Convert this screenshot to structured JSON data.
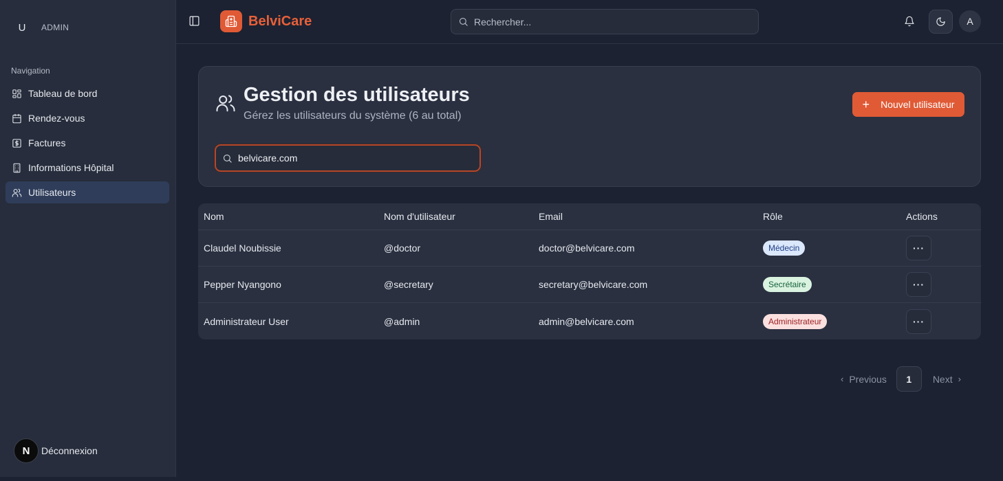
{
  "sidebar": {
    "user_initial": "U",
    "user_role": "ADMIN",
    "section_label": "Navigation",
    "items": [
      {
        "label": "Tableau de bord",
        "icon": "dashboard-icon"
      },
      {
        "label": "Rendez-vous",
        "icon": "calendar-icon"
      },
      {
        "label": "Factures",
        "icon": "invoice-icon"
      },
      {
        "label": "Informations Hôpital",
        "icon": "building-icon"
      },
      {
        "label": "Utilisateurs",
        "icon": "users-icon",
        "active": true
      }
    ],
    "logout_initial": "N",
    "logout_label": "Déconnexion"
  },
  "topbar": {
    "brand_name": "BelviCare",
    "search_placeholder": "Rechercher...",
    "user_initial": "A"
  },
  "header_card": {
    "title": "Gestion des utilisateurs",
    "subtitle": "Gérez les utilisateurs du système (6 au total)",
    "new_button_label": "Nouvel utilisateur",
    "search_value": "belvicare.com"
  },
  "table": {
    "columns": [
      "Nom",
      "Nom d'utilisateur",
      "Email",
      "Rôle",
      "Actions"
    ],
    "rows": [
      {
        "name": "Claudel Noubissie",
        "username": "@doctor",
        "email": "doctor@belvicare.com",
        "role": "Médecin",
        "role_bg": "#dbe7fb",
        "role_fg": "#1f3f86"
      },
      {
        "name": "Pepper Nyangono",
        "username": "@secretary",
        "email": "secretary@belvicare.com",
        "role": "Secrétaire",
        "role_bg": "#daf3e1",
        "role_fg": "#17603a"
      },
      {
        "name": "Administrateur User",
        "username": "@admin",
        "email": "admin@belvicare.com",
        "role": "Administrateur",
        "role_bg": "#fbe0e0",
        "role_fg": "#9b1c1c"
      }
    ],
    "action_label": "···"
  },
  "pagination": {
    "previous_label": "Previous",
    "current_page": "1",
    "next_label": "Next"
  },
  "colors": {
    "accent": "#e05a36",
    "background": "#1c2231",
    "sidebar": "#272d3c",
    "card": "#2a3040"
  }
}
